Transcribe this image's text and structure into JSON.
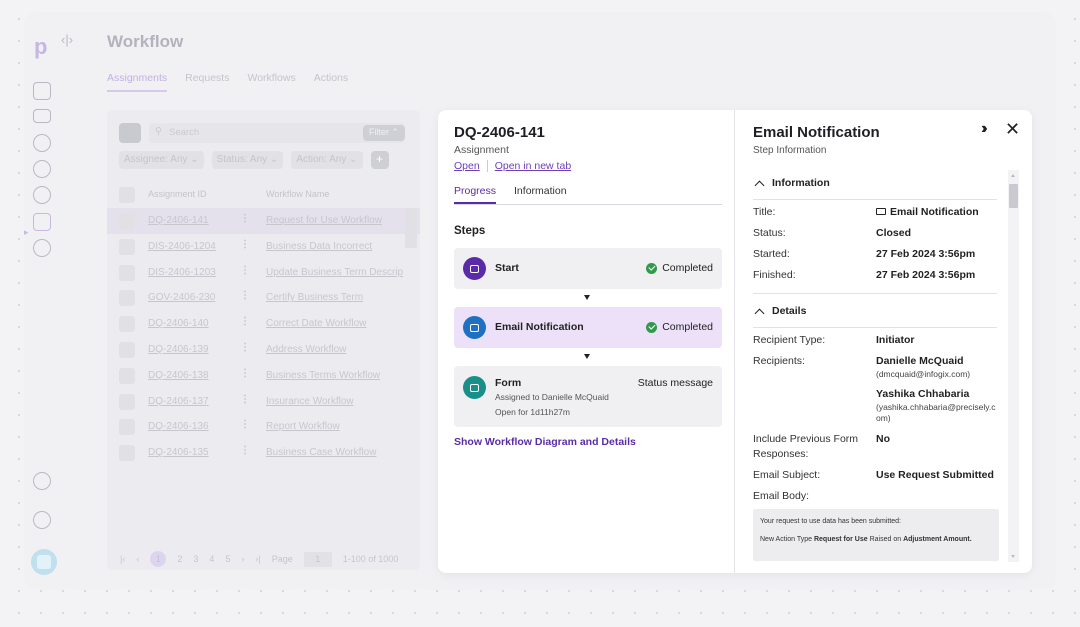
{
  "app": {
    "page_title": "Workflow",
    "tabs": [
      "Assignments",
      "Requests",
      "Workflows",
      "Actions"
    ]
  },
  "background_list": {
    "search_placeholder": "Search",
    "filter_label": "Filter",
    "chips": [
      "Assignee: Any",
      "Status: Any",
      "Action: Any"
    ],
    "columns": [
      "Assignment ID",
      "Workflow Name"
    ],
    "rows": [
      {
        "id": "DQ-2406-141",
        "name": "Request for Use Workflow"
      },
      {
        "id": "DIS-2406-1204",
        "name": "Business Data Incorrect"
      },
      {
        "id": "DIS-2406-1203",
        "name": "Update Business Term Descrip"
      },
      {
        "id": "GOV-2406-230",
        "name": "Certify Business Term"
      },
      {
        "id": "DQ-2406-140",
        "name": "Correct Date Workflow"
      },
      {
        "id": "DQ-2406-139",
        "name": "Address Workflow"
      },
      {
        "id": "DQ-2406-138",
        "name": "Business Terms Workflow"
      },
      {
        "id": "DQ-2406-137",
        "name": "Insurance Workflow"
      },
      {
        "id": "DQ-2406-136",
        "name": "Report Workflow"
      },
      {
        "id": "DQ-2406-135",
        "name": "Business Case Workflow"
      }
    ],
    "pager": {
      "pages": [
        "1",
        "2",
        "3",
        "4",
        "5"
      ],
      "page_label": "Page",
      "page_value": "1",
      "range": "1-100 of 1000"
    }
  },
  "assignment": {
    "title": "DQ-2406-141",
    "subtitle": "Assignment",
    "open_link": "Open",
    "open_new_tab_link": "Open in new tab",
    "tabs": [
      "Progress",
      "Information"
    ],
    "steps_heading": "Steps",
    "steps": [
      {
        "name": "Start",
        "status": "Completed",
        "icon": "play-icon",
        "color": "#5b2aa8"
      },
      {
        "name": "Email Notification",
        "status": "Completed",
        "icon": "mail-icon",
        "color": "#1f6fc2"
      },
      {
        "name": "Form",
        "status": "Status message",
        "icon": "form-icon",
        "color": "#1a8f8a",
        "assigned": "Assigned to Danielle McQuaid",
        "open_for": "Open for 1d11h27m"
      }
    ],
    "show_link": "Show Workflow Diagram and Details"
  },
  "step_info": {
    "title": "Email Notification",
    "subtitle": "Step Information",
    "information_heading": "Information",
    "info": {
      "title_label": "Title:",
      "title_value": "Email Notification",
      "status_label": "Status:",
      "status_value": "Closed",
      "started_label": "Started:",
      "started_value": "27 Feb 2024 3:56pm",
      "finished_label": "Finished:",
      "finished_value": "27 Feb 2024 3:56pm"
    },
    "details_heading": "Details",
    "details": {
      "recipient_type_label": "Recipient Type:",
      "recipient_type_value": "Initiator",
      "recipients_label": "Recipients:",
      "recipients": [
        {
          "name": "Danielle McQuaid",
          "email": "(dmcquaid@infogix.com)"
        },
        {
          "name": "Yashika Chhabaria",
          "email": "(yashika.chhabaria@precisely.com)"
        }
      ],
      "include_prev_label_1": "Include Previous Form",
      "include_prev_label_2": "Responses:",
      "include_prev_value": "No",
      "subject_label": "Email Subject:",
      "subject_value": "Use Request Submitted",
      "body_label": "Email Body:",
      "body_line1": "Your request to use data has been submitted:",
      "body_line2_a": "New Action Type ",
      "body_line2_b": "Request for Use",
      "body_line2_c": " Raised on ",
      "body_line2_d": "Adjustment Amount."
    }
  }
}
